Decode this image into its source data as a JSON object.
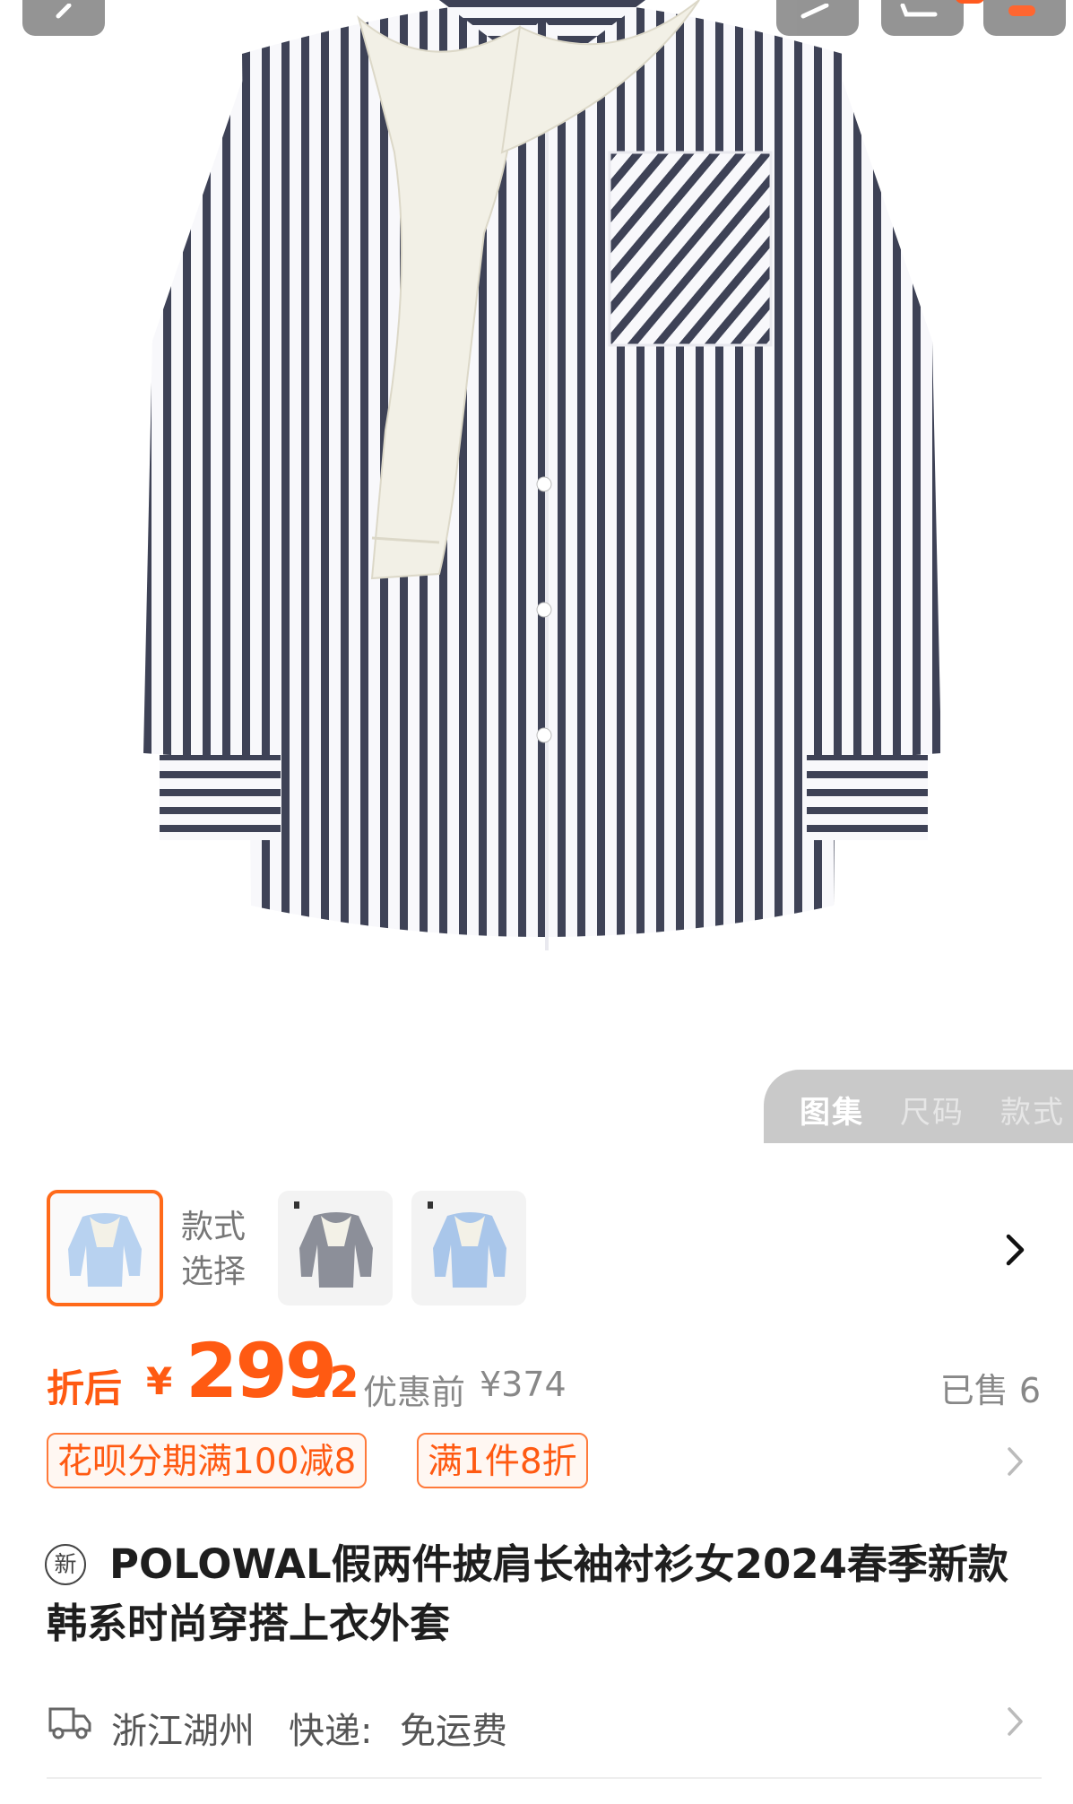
{
  "gallery": {
    "tabs": [
      {
        "label": "图集",
        "active": true
      },
      {
        "label": "尺码",
        "active": false
      },
      {
        "label": "款式",
        "active": false
      }
    ]
  },
  "style_selector": {
    "label_line1": "款式",
    "label_line2": "选择",
    "options": [
      {
        "name": "light-blue-striped",
        "selected": true
      },
      {
        "name": "grey-striped",
        "selected": false
      },
      {
        "name": "blue-striped",
        "selected": false
      }
    ]
  },
  "price": {
    "prefix": "折后",
    "currency": "¥",
    "integer": "299",
    "decimal": ".2",
    "original_label": "优惠前",
    "original_price": "¥374",
    "sold_text": "已售 6"
  },
  "promos": [
    "花呗分期满100减8",
    "满1件8折"
  ],
  "product": {
    "new_badge": "新",
    "title": "POLOWAL假两件披肩长袖衬衫女2024春季新款韩系时尚穿搭上衣外套"
  },
  "shipping": {
    "origin": "浙江湖州",
    "method_label": "快递:",
    "fee": "免运费"
  },
  "colors": {
    "accent": "#ff5a12",
    "stripe": "#3e4256",
    "sweater": "#f2f0e6"
  }
}
